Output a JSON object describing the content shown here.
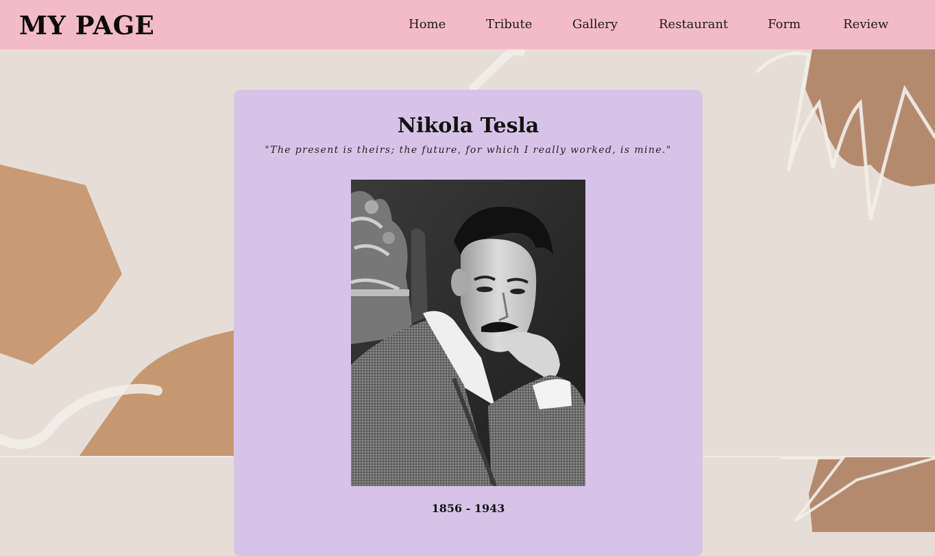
{
  "header": {
    "brand": "MY PAGE",
    "nav": [
      {
        "label": "Home"
      },
      {
        "label": "Tribute"
      },
      {
        "label": "Gallery"
      },
      {
        "label": "Restaurant"
      },
      {
        "label": "Form"
      },
      {
        "label": "Review"
      }
    ]
  },
  "tribute": {
    "title": "Nikola Tesla",
    "quote": "\"The present is theirs; the future, for which I really worked, is mine.\"",
    "image_alt": "Portrait of Nikola Tesla",
    "years": "1856 - 1943"
  },
  "colors": {
    "header_bg": "#f3bbc6",
    "card_bg": "#d8c3e8",
    "page_bg": "#e6ddd6",
    "accent_shape": "#c79a74"
  }
}
